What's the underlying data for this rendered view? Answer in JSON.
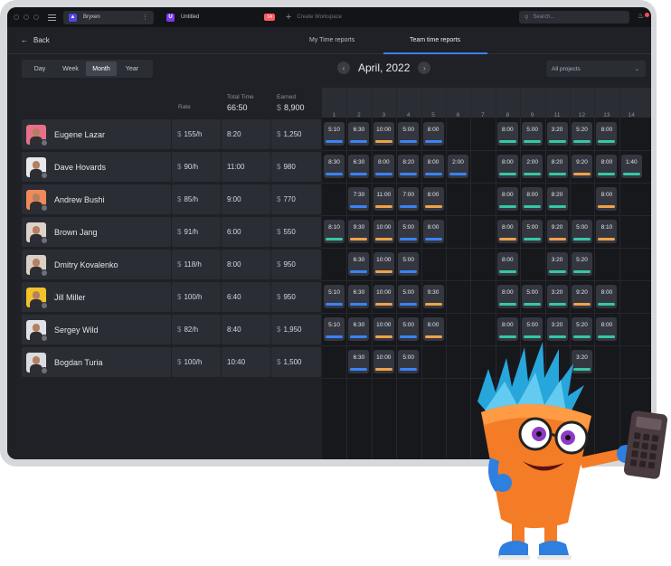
{
  "window": {
    "tabs": [
      {
        "label": "Bryxen",
        "active": true,
        "icon": "bryxen-logo-icon"
      },
      {
        "label": "Untitled",
        "active": false,
        "icon": "u-logo-icon",
        "badge": "14"
      }
    ],
    "create_workspace": "Create Workspace",
    "search_placeholder": "Search..."
  },
  "nav": {
    "back": "Back",
    "tabs": [
      "My Time reports",
      "Team time reports"
    ],
    "active_tab": "Team time reports"
  },
  "period": {
    "options": [
      "Day",
      "Week",
      "Month",
      "Year"
    ],
    "selected": "Month",
    "month_label": "April, 2022",
    "project_select": "All projects"
  },
  "table": {
    "headers": {
      "rate": "Rate",
      "total_time": "Total Time",
      "earned": "Earned"
    },
    "totals": {
      "total_time": "66:50",
      "earned": "8,900",
      "currency": "$"
    },
    "members": [
      {
        "name": "Eugene Lazar",
        "rate": "155/h",
        "time": "8:20",
        "earned": "1,250"
      },
      {
        "name": "Dave Hovards",
        "rate": "90/h",
        "time": "11:00",
        "earned": "980"
      },
      {
        "name": "Andrew Bushi",
        "rate": "85/h",
        "time": "9:00",
        "earned": "770"
      },
      {
        "name": "Brown Jang",
        "rate": "91/h",
        "time": "6:00",
        "earned": "550"
      },
      {
        "name": "Dmitry Kovalenko",
        "rate": "118/h",
        "time": "8:00",
        "earned": "950"
      },
      {
        "name": "Jill Miller",
        "rate": "100/h",
        "time": "6:40",
        "earned": "950"
      },
      {
        "name": "Sergey Wild",
        "rate": "82/h",
        "time": "8:40",
        "earned": "1,950"
      },
      {
        "name": "Bogdan Turia",
        "rate": "100/h",
        "time": "10:40",
        "earned": "1,500"
      }
    ]
  },
  "calendar": {
    "days": [
      "1",
      "2",
      "3",
      "4",
      "5",
      "6",
      "7",
      "8",
      "9",
      "11",
      "12",
      "13",
      "14"
    ],
    "entries": [
      [
        [
          "5:10",
          "blue"
        ],
        [
          "6:30",
          "blue"
        ],
        [
          "10:00",
          "orange"
        ],
        [
          "5:00",
          "blue"
        ],
        [
          "8:00",
          "blue"
        ],
        null,
        null,
        [
          "8:00",
          "teal"
        ],
        [
          "5:00",
          "teal"
        ],
        [
          "3:20",
          "teal"
        ],
        [
          "5:20",
          "teal"
        ],
        [
          "8:00",
          "teal"
        ],
        null
      ],
      [
        [
          "8:30",
          "blue"
        ],
        [
          "6:30",
          "blue"
        ],
        [
          "8:00",
          "blue"
        ],
        [
          "8:20",
          "blue"
        ],
        [
          "8:00",
          "blue"
        ],
        [
          "2:00",
          "blue"
        ],
        null,
        [
          "8:00",
          "teal"
        ],
        [
          "2:00",
          "teal"
        ],
        [
          "8:20",
          "teal"
        ],
        [
          "9:20",
          "orange"
        ],
        [
          "8:00",
          "teal"
        ],
        [
          "1:40",
          "teal"
        ]
      ],
      [
        null,
        [
          "7:30",
          "blue"
        ],
        [
          "11:00",
          "orange"
        ],
        [
          "7:00",
          "blue"
        ],
        [
          "8:00",
          "orange"
        ],
        null,
        null,
        [
          "8:00",
          "teal"
        ],
        [
          "8:00",
          "teal"
        ],
        [
          "8:20",
          "teal"
        ],
        null,
        [
          "8:00",
          "orange"
        ],
        null
      ],
      [
        [
          "8:10",
          "teal"
        ],
        [
          "9:30",
          "orange"
        ],
        [
          "10:00",
          "orange"
        ],
        [
          "5:00",
          "blue"
        ],
        [
          "8:00",
          "blue"
        ],
        null,
        null,
        [
          "8:00",
          "orange"
        ],
        [
          "5:00",
          "teal"
        ],
        [
          "9:20",
          "orange"
        ],
        [
          "5:00",
          "teal"
        ],
        [
          "8:10",
          "orange"
        ],
        null
      ],
      [
        null,
        [
          "6:30",
          "blue"
        ],
        [
          "10:00",
          "orange"
        ],
        [
          "5:00",
          "blue"
        ],
        null,
        null,
        null,
        [
          "8:00",
          "teal"
        ],
        null,
        [
          "3:20",
          "teal"
        ],
        [
          "5:20",
          "teal"
        ],
        null,
        null
      ],
      [
        [
          "5:10",
          "blue"
        ],
        [
          "6:30",
          "blue"
        ],
        [
          "10:00",
          "orange"
        ],
        [
          "5:00",
          "blue"
        ],
        [
          "9:30",
          "orange"
        ],
        null,
        null,
        [
          "8:00",
          "teal"
        ],
        [
          "5:00",
          "teal"
        ],
        [
          "3:20",
          "teal"
        ],
        [
          "9:20",
          "orange"
        ],
        [
          "8:00",
          "teal"
        ],
        null
      ],
      [
        [
          "5:10",
          "blue"
        ],
        [
          "6:30",
          "blue"
        ],
        [
          "10:00",
          "orange"
        ],
        [
          "5:00",
          "blue"
        ],
        [
          "8:00",
          "orange"
        ],
        null,
        null,
        [
          "8:00",
          "teal"
        ],
        [
          "5:00",
          "teal"
        ],
        [
          "3:20",
          "teal"
        ],
        [
          "5:20",
          "teal"
        ],
        [
          "8:00",
          "teal"
        ],
        null
      ],
      [
        null,
        [
          "6:30",
          "blue"
        ],
        [
          "10:00",
          "orange"
        ],
        [
          "5:00",
          "blue"
        ],
        null,
        null,
        null,
        null,
        null,
        null,
        [
          "3:20",
          "teal"
        ],
        null,
        null
      ]
    ]
  },
  "colors": {
    "blue": "#3b82f6",
    "orange": "#f0a24a",
    "teal": "#35c7a6",
    "accent": "#3b82f6"
  }
}
